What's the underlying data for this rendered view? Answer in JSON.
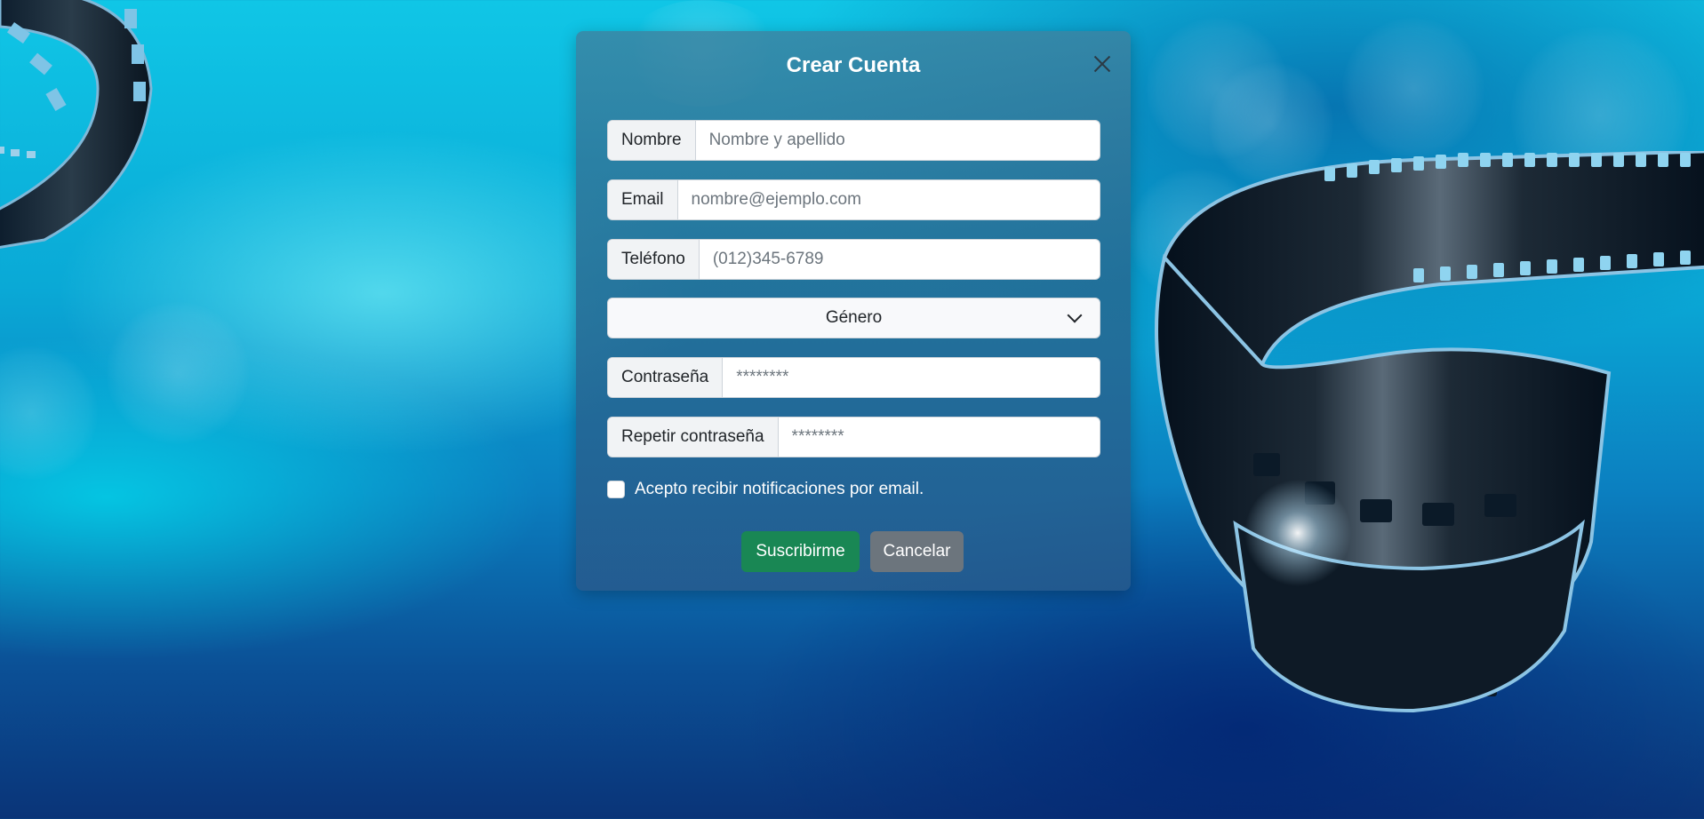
{
  "page": {
    "background_color": "#0aa9d6"
  },
  "modal": {
    "title": "Crear Cuenta",
    "close_icon": "close-icon",
    "fields": [
      {
        "label": "Nombre",
        "placeholder": "Nombre y apellido",
        "value": ""
      },
      {
        "label": "Email",
        "placeholder": "nombre@ejemplo.com",
        "value": ""
      },
      {
        "label": "Teléfono",
        "placeholder": "(012)345-6789",
        "value": ""
      },
      {
        "label": "Contraseña",
        "placeholder": "********",
        "value": ""
      },
      {
        "label": "Repetir contraseña",
        "placeholder": "********",
        "value": ""
      }
    ],
    "gender_select": {
      "selected": "Género",
      "icon": "chevron-down-icon"
    },
    "notifications_checkbox": {
      "label": "Acepto recibir notificaciones por email.",
      "checked": false
    },
    "buttons": {
      "submit_label": "Suscribirme",
      "submit_color": "#198754",
      "cancel_label": "Cancelar",
      "cancel_color": "#6c757d"
    }
  }
}
